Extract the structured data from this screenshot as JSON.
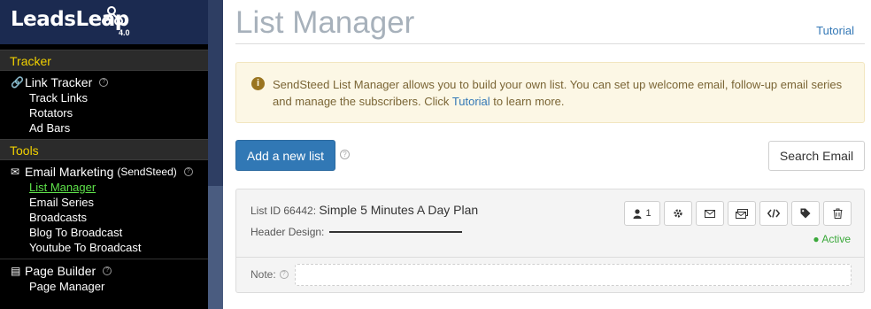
{
  "logo": {
    "word1": "Leads",
    "word2": "Leap",
    "version": "4.0"
  },
  "sidebar": {
    "sections": [
      {
        "label": "Tracker",
        "groups": [
          {
            "title": "Link Tracker",
            "icon": "link-icon",
            "items": [
              "Track Links",
              "Rotators",
              "Ad Bars"
            ]
          }
        ]
      },
      {
        "label": "Tools",
        "groups": [
          {
            "title": "Email Marketing",
            "subtitle": "(SendSteed)",
            "icon": "envelope-icon",
            "items": [
              "List Manager",
              "Email Series",
              "Broadcasts",
              "Blog To Broadcast",
              "Youtube To Broadcast"
            ],
            "active": "List Manager"
          },
          {
            "title": "Page Builder",
            "icon": "page-icon",
            "items": [
              "Page Manager"
            ]
          }
        ]
      }
    ]
  },
  "main": {
    "title": "List Manager",
    "tutorial_link": "Tutorial",
    "info": {
      "text_before": "SendSteed List Manager allows you to build your own list. You can set up welcome email, follow-up email series and manage the subscribers. Click ",
      "link": "Tutorial",
      "text_after": " to learn more."
    },
    "add_button": "Add a new list",
    "search_button": "Search Email",
    "list": {
      "id_label": "List ID 66442:",
      "name": "Simple 5 Minutes A Day Plan",
      "header_design_label": "Header Design:",
      "subscriber_count": "1",
      "status": "Active",
      "note_label": "Note:"
    }
  },
  "colors": {
    "accent": "#3178b5",
    "active_menu": "#5ee24a",
    "section_header": "#f0d000",
    "status": "#3aa83a"
  }
}
